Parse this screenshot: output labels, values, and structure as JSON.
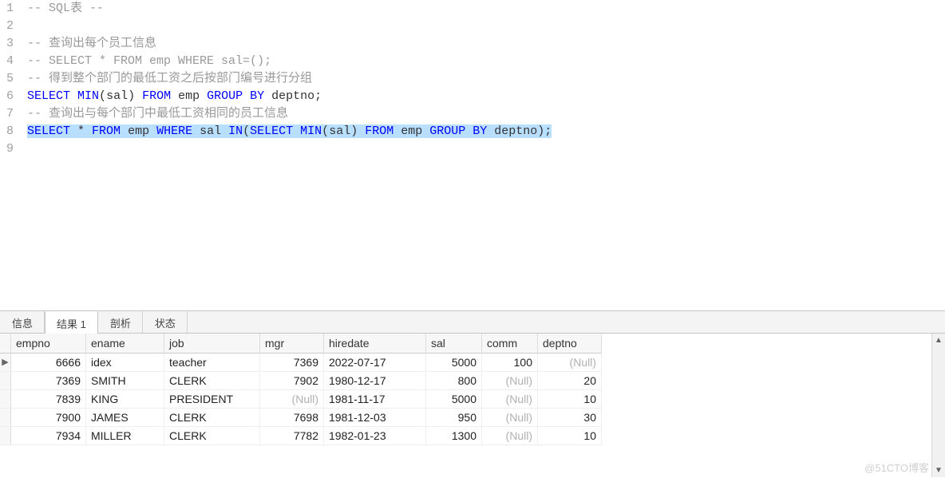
{
  "editor": {
    "lineNumbers": [
      "1",
      "2",
      "3",
      "4",
      "5",
      "6",
      "7",
      "8",
      "9"
    ],
    "lines": [
      {
        "kind": "cmt",
        "text": "-- SQL表 --"
      },
      {
        "kind": "blank",
        "text": ""
      },
      {
        "kind": "cmt",
        "text": "-- 查询出每个员工信息"
      },
      {
        "kind": "cmt",
        "text": "-- SELECT * FROM emp WHERE sal=();"
      },
      {
        "kind": "cmt",
        "text": "-- 得到整个部门的最低工资之后按部门编号进行分组"
      },
      {
        "kind": "sql6",
        "tokens": {
          "kw1": "SELECT ",
          "fn": "MIN",
          "op1": "(",
          "id1": "sal",
          "op2": ") ",
          "kw2": "FROM ",
          "id2": "emp ",
          "kw3": "GROUP BY ",
          "id3": "deptno",
          "op3": ";"
        }
      },
      {
        "kind": "cmt",
        "text": "-- 查询出与每个部门中最低工资相同的员工信息"
      },
      {
        "kind": "sql8",
        "tokens": {
          "kw1": "SELECT ",
          "op1": "* ",
          "kw2": "FROM ",
          "id1": "emp ",
          "kw3": "WHERE ",
          "id2": "sal ",
          "kw4": "IN",
          "op2": "(",
          "kw5": "SELECT ",
          "fn": "MIN",
          "op3": "(",
          "id3": "sal",
          "op4": ") ",
          "kw6": "FROM ",
          "id4": "emp ",
          "kw7": "GROUP BY ",
          "id5": "deptno",
          "op5": ");"
        }
      },
      {
        "kind": "blank",
        "text": ""
      }
    ]
  },
  "tabs": {
    "info": "信息",
    "result": "结果 1",
    "profile": "剖析",
    "status": "状态"
  },
  "table": {
    "headers": {
      "empno": "empno",
      "ename": "ename",
      "job": "job",
      "mgr": "mgr",
      "hiredate": "hiredate",
      "sal": "sal",
      "comm": "comm",
      "deptno": "deptno"
    },
    "rows": [
      {
        "marker": "▶",
        "empno": "6666",
        "ename": "idex",
        "job": "teacher",
        "mgr": "7369",
        "hiredate": "2022-07-17",
        "sal": "5000",
        "comm": "100",
        "deptno": "(Null)",
        "deptnoNull": true,
        "mgrNull": false,
        "commNull": false
      },
      {
        "marker": "",
        "empno": "7369",
        "ename": "SMITH",
        "job": "CLERK",
        "mgr": "7902",
        "hiredate": "1980-12-17",
        "sal": "800",
        "comm": "(Null)",
        "deptno": "20",
        "deptnoNull": false,
        "mgrNull": false,
        "commNull": true
      },
      {
        "marker": "",
        "empno": "7839",
        "ename": "KING",
        "job": "PRESIDENT",
        "mgr": "(Null)",
        "hiredate": "1981-11-17",
        "sal": "5000",
        "comm": "(Null)",
        "deptno": "10",
        "deptnoNull": false,
        "mgrNull": true,
        "commNull": true
      },
      {
        "marker": "",
        "empno": "7900",
        "ename": "JAMES",
        "job": "CLERK",
        "mgr": "7698",
        "hiredate": "1981-12-03",
        "sal": "950",
        "comm": "(Null)",
        "deptno": "30",
        "deptnoNull": false,
        "mgrNull": false,
        "commNull": true
      },
      {
        "marker": "",
        "empno": "7934",
        "ename": "MILLER",
        "job": "CLERK",
        "mgr": "7782",
        "hiredate": "1982-01-23",
        "sal": "1300",
        "comm": "(Null)",
        "deptno": "10",
        "deptnoNull": false,
        "mgrNull": false,
        "commNull": true
      }
    ]
  },
  "watermark": "@51CTO博客"
}
